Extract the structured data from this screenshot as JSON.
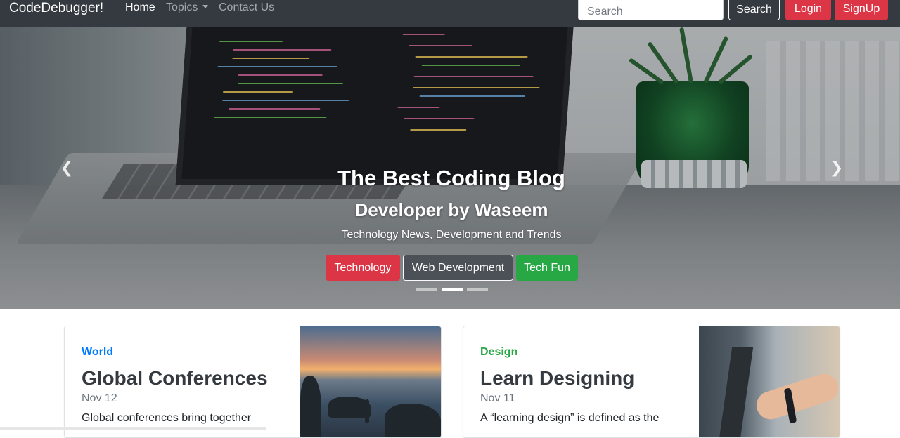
{
  "navbar": {
    "brand": "CodeDebugger!",
    "links": [
      {
        "label": "Home",
        "active": true
      },
      {
        "label": "Topics",
        "dropdown": true
      },
      {
        "label": "Contact Us"
      }
    ],
    "search_placeholder": "Search",
    "search_button": "Search",
    "login_button": "Login",
    "signup_button": "SignUp"
  },
  "hero": {
    "title": "The Best Coding Blog",
    "subtitle": "Developer by Waseem",
    "tagline": "Technology News, Development and Trends",
    "buttons": [
      {
        "label": "Technology",
        "color": "#dc3545"
      },
      {
        "label": "Web Development",
        "color": "#343a40"
      },
      {
        "label": "Tech Fun",
        "color": "#28a745"
      }
    ],
    "slides": 3,
    "active_slide": 2,
    "prev_icon": "chevron-left-icon",
    "next_icon": "chevron-right-icon"
  },
  "cards": [
    {
      "category": "World",
      "category_color": "#007bff",
      "title": "Global Conferences",
      "date": "Nov 12",
      "text": "Global conferences bring together"
    },
    {
      "category": "Design",
      "category_color": "#28a745",
      "title": "Learn Designing",
      "date": "Nov 11",
      "text": "A “learning design” is defined as the"
    }
  ]
}
